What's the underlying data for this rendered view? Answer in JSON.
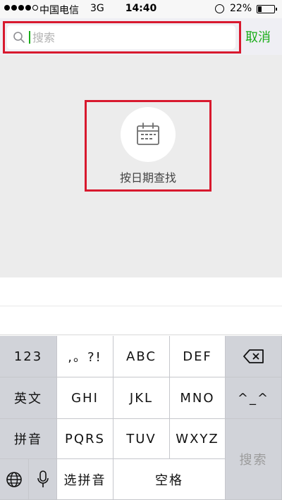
{
  "status_bar": {
    "carrier": "中国电信",
    "network": "3G",
    "time": "14:40",
    "battery_percent": "22%",
    "battery_level": 0.22
  },
  "search": {
    "placeholder": "搜索",
    "value": "",
    "cancel_label": "取消"
  },
  "date_search": {
    "label": "按日期查找",
    "icon": "calendar-icon"
  },
  "keyboard": {
    "row1": [
      "123",
      ",。?!",
      "ABC",
      "DEF"
    ],
    "row2": [
      "英文",
      "GHI",
      "JKL",
      "MNO",
      "^_^"
    ],
    "row3": [
      "拼音",
      "PQRS",
      "TUV",
      "WXYZ"
    ],
    "row4": [
      "选拼音",
      "空格"
    ],
    "search_key": "搜索",
    "icons": {
      "backspace": "backspace-icon",
      "globe": "globe-icon",
      "mic": "microphone-icon"
    }
  },
  "colors": {
    "accent": "#1aad19",
    "highlight": "#d8192e"
  }
}
